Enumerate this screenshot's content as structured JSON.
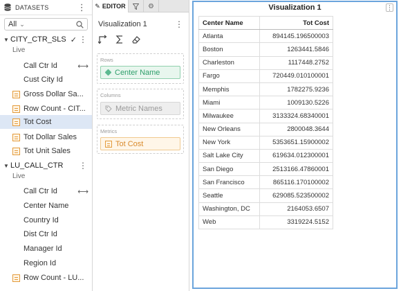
{
  "datasets": {
    "header": "DATASETS",
    "filter": {
      "value": "All"
    },
    "groups": [
      {
        "name": "CITY_CTR_SLS",
        "status": "Live",
        "fields": [
          {
            "label": "Call Ctr Id",
            "kind": "attribute",
            "linked": true,
            "selected": false
          },
          {
            "label": "Cust City Id",
            "kind": "attribute",
            "linked": false,
            "selected": false
          },
          {
            "label": "Gross Dollar Sa...",
            "kind": "metric",
            "linked": false,
            "selected": false
          },
          {
            "label": "Row Count - CIT...",
            "kind": "metric",
            "linked": false,
            "selected": false
          },
          {
            "label": "Tot Cost",
            "kind": "metric",
            "linked": false,
            "selected": true
          },
          {
            "label": "Tot Dollar Sales",
            "kind": "metric",
            "linked": false,
            "selected": false
          },
          {
            "label": "Tot Unit Sales",
            "kind": "metric",
            "linked": false,
            "selected": false
          }
        ]
      },
      {
        "name": "LU_CALL_CTR",
        "status": "Live",
        "fields": [
          {
            "label": "Call Ctr Id",
            "kind": "attribute",
            "linked": true,
            "selected": false
          },
          {
            "label": "Center Name",
            "kind": "attribute",
            "linked": false,
            "selected": false
          },
          {
            "label": "Country Id",
            "kind": "attribute",
            "linked": false,
            "selected": false
          },
          {
            "label": "Dist Ctr Id",
            "kind": "attribute",
            "linked": false,
            "selected": false
          },
          {
            "label": "Manager Id",
            "kind": "attribute",
            "linked": false,
            "selected": false
          },
          {
            "label": "Region Id",
            "kind": "attribute",
            "linked": false,
            "selected": false
          },
          {
            "label": "Row Count - LU...",
            "kind": "metric",
            "linked": false,
            "selected": false
          }
        ]
      }
    ]
  },
  "editor": {
    "tab_label": "EDITOR",
    "viz_title": "Visualization 1",
    "zones": {
      "rows": {
        "label": "Rows",
        "item": "Center Name"
      },
      "columns": {
        "label": "Columns",
        "item": "Metric Names"
      },
      "metrics": {
        "label": "Metrics",
        "item": "Tot Cost"
      }
    }
  },
  "visualization": {
    "title": "Visualization 1",
    "columns": [
      "Center Name",
      "Tot Cost"
    ],
    "rows": [
      [
        "Atlanta",
        "894145.196500003"
      ],
      [
        "Boston",
        "1263441.5846"
      ],
      [
        "Charleston",
        "1117448.2752"
      ],
      [
        "Fargo",
        "720449.010100001"
      ],
      [
        "Memphis",
        "1782275.9236"
      ],
      [
        "Miami",
        "1009130.5226"
      ],
      [
        "Milwaukee",
        "3133324.68340001"
      ],
      [
        "New Orleans",
        "2800048.3644"
      ],
      [
        "New York",
        "5353651.15900002"
      ],
      [
        "Salt Lake City",
        "619634.012300001"
      ],
      [
        "San Diego",
        "2513166.47860001"
      ],
      [
        "San Francisco",
        "865116.170100002"
      ],
      [
        "Seattle",
        "629085.523500002"
      ],
      [
        "Washington, DC",
        "2164053.6507"
      ],
      [
        "Web",
        "3319224.5152"
      ]
    ]
  },
  "colors": {
    "attribute": "#5cb990",
    "metric": "#e39a3a",
    "selection": "#dde7f5",
    "viz_border": "#6aa4dc"
  }
}
